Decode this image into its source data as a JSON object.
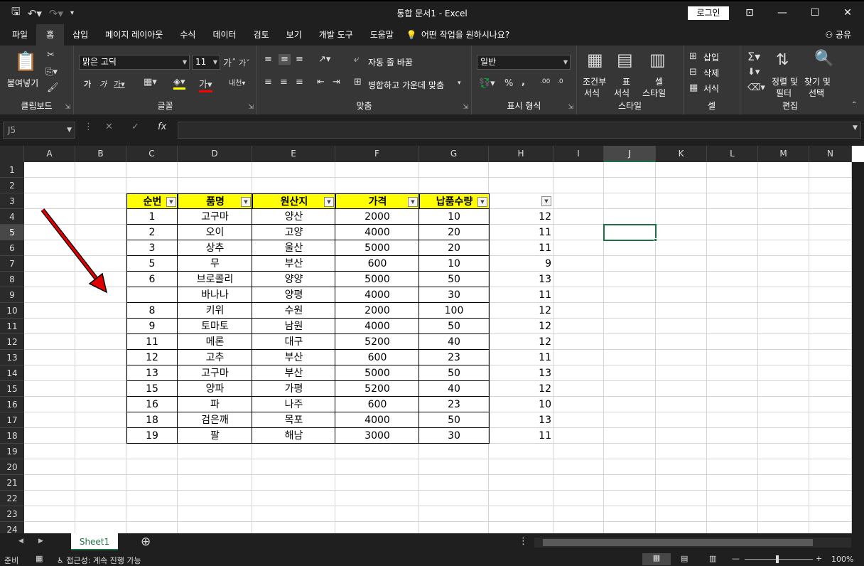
{
  "window": {
    "title": "통합 문서1  -  Excel",
    "login": "로그인"
  },
  "tabs": [
    "파일",
    "홈",
    "삽입",
    "페이지 레이아웃",
    "수식",
    "데이터",
    "검토",
    "보기",
    "개발 도구",
    "도움말"
  ],
  "active_tab": "홈",
  "tellme": "어떤 작업을 원하시나요?",
  "share": "공유",
  "ribbon": {
    "clipboard": {
      "paste": "붙여넣기",
      "label": "클립보드"
    },
    "font": {
      "name": "맑은 고딕",
      "size": "11",
      "label": "글꼴"
    },
    "align": {
      "wrap": "자동 줄 바꿈",
      "merge": "병합하고 가운데 맞춤",
      "label": "맞춤"
    },
    "number": {
      "format": "일반",
      "label": "표시 형식"
    },
    "styles": {
      "cond1": "조건부",
      "cond2": "서식",
      "table1": "표",
      "table2": "서식",
      "cell1": "셀",
      "cell2": "스타일",
      "label": "스타일"
    },
    "cells": {
      "insert": "삽입",
      "delete": "삭제",
      "format": "서식",
      "label": "셀"
    },
    "edit": {
      "sort1": "정렬 및",
      "sort2": "필터",
      "find1": "찾기 및",
      "find2": "선택",
      "label": "편집"
    }
  },
  "namebox": "J5",
  "columns": [
    "A",
    "B",
    "C",
    "D",
    "E",
    "F",
    "G",
    "H",
    "I",
    "J",
    "K",
    "L",
    "M",
    "N"
  ],
  "selected_col": "J",
  "selected_row": 5,
  "table": {
    "headers": [
      "순번",
      "품명",
      "원산지",
      "가격",
      "납품수량"
    ],
    "rows": [
      [
        "1",
        "고구마",
        "양산",
        "2000",
        "10"
      ],
      [
        "2",
        "오이",
        "고양",
        "4000",
        "20"
      ],
      [
        "3",
        "상추",
        "울산",
        "5000",
        "20"
      ],
      [
        "5",
        "무",
        "부산",
        "600",
        "10"
      ],
      [
        "6",
        "브로콜리",
        "양양",
        "5000",
        "50"
      ],
      [
        "",
        "바나나",
        "양평",
        "4000",
        "30"
      ],
      [
        "8",
        "키위",
        "수원",
        "2000",
        "100"
      ],
      [
        "9",
        "토마토",
        "남원",
        "4000",
        "50"
      ],
      [
        "11",
        "메론",
        "대구",
        "5200",
        "40"
      ],
      [
        "12",
        "고추",
        "부산",
        "600",
        "23"
      ],
      [
        "13",
        "고구마",
        "부산",
        "5000",
        "50"
      ],
      [
        "15",
        "양파",
        "가평",
        "5200",
        "40"
      ],
      [
        "16",
        "파",
        "나주",
        "600",
        "23"
      ],
      [
        "18",
        "검은깨",
        "목포",
        "4000",
        "50"
      ],
      [
        "19",
        "팔",
        "해남",
        "3000",
        "30"
      ]
    ]
  },
  "colH": [
    "12",
    "11",
    "11",
    "9",
    "13",
    "11",
    "12",
    "12",
    "12",
    "11",
    "13",
    "12",
    "10",
    "13",
    "11"
  ],
  "sheet": "Sheet1",
  "status": {
    "ready": "준비",
    "access": "접근성: 계속 진행 가능",
    "zoom": "100%"
  }
}
